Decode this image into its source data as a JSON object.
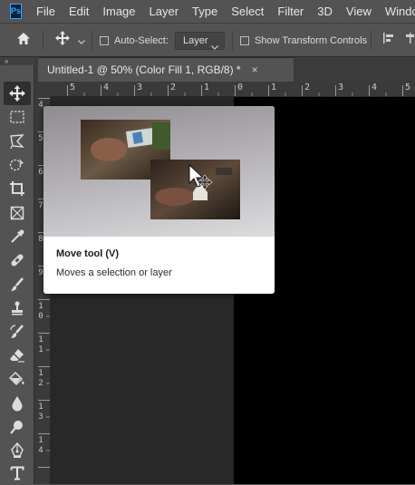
{
  "app": {
    "logo": "Ps"
  },
  "menu": [
    "File",
    "Edit",
    "Image",
    "Layer",
    "Type",
    "Select",
    "Filter",
    "3D",
    "View",
    "Window"
  ],
  "options": {
    "home_icon": "home-icon",
    "move_icon": "move-arrows-icon",
    "auto_select_label": "Auto-Select:",
    "layer_select_value": "Layer",
    "show_transform_label": "Show Transform Controls",
    "align_icon": "align-left-icon"
  },
  "document_tab": {
    "title": "Untitled-1 @ 50% (Color Fill 1, RGB/8) *",
    "close": "×"
  },
  "ruler_top": [
    "5",
    "4",
    "3",
    "2",
    "1",
    "0",
    "1",
    "2",
    "3",
    "4",
    "5"
  ],
  "ruler_left": [
    "4",
    "5",
    "6",
    "7",
    "8",
    "9",
    "1\n0",
    "1\n1",
    "1\n2",
    "1\n3",
    "1\n4"
  ],
  "tools": [
    "move-tool-icon",
    "marquee-tool-icon",
    "lasso-tool-icon",
    "quick-select-tool-icon",
    "crop-tool-icon",
    "frame-tool-icon",
    "eyedropper-tool-icon",
    "healing-brush-tool-icon",
    "brush-tool-icon",
    "clone-stamp-tool-icon",
    "history-brush-tool-icon",
    "eraser-tool-icon",
    "paint-bucket-tool-icon",
    "blur-tool-icon",
    "dodge-tool-icon",
    "pen-tool-icon",
    "type-tool-icon"
  ],
  "tooltip": {
    "title": "Move tool (V)",
    "description": "Moves a selection or layer"
  },
  "colors": {
    "ui_bg": "#535353",
    "canvas": "#000000",
    "pasteboard": "#282828",
    "brand": "#31a8ff"
  }
}
